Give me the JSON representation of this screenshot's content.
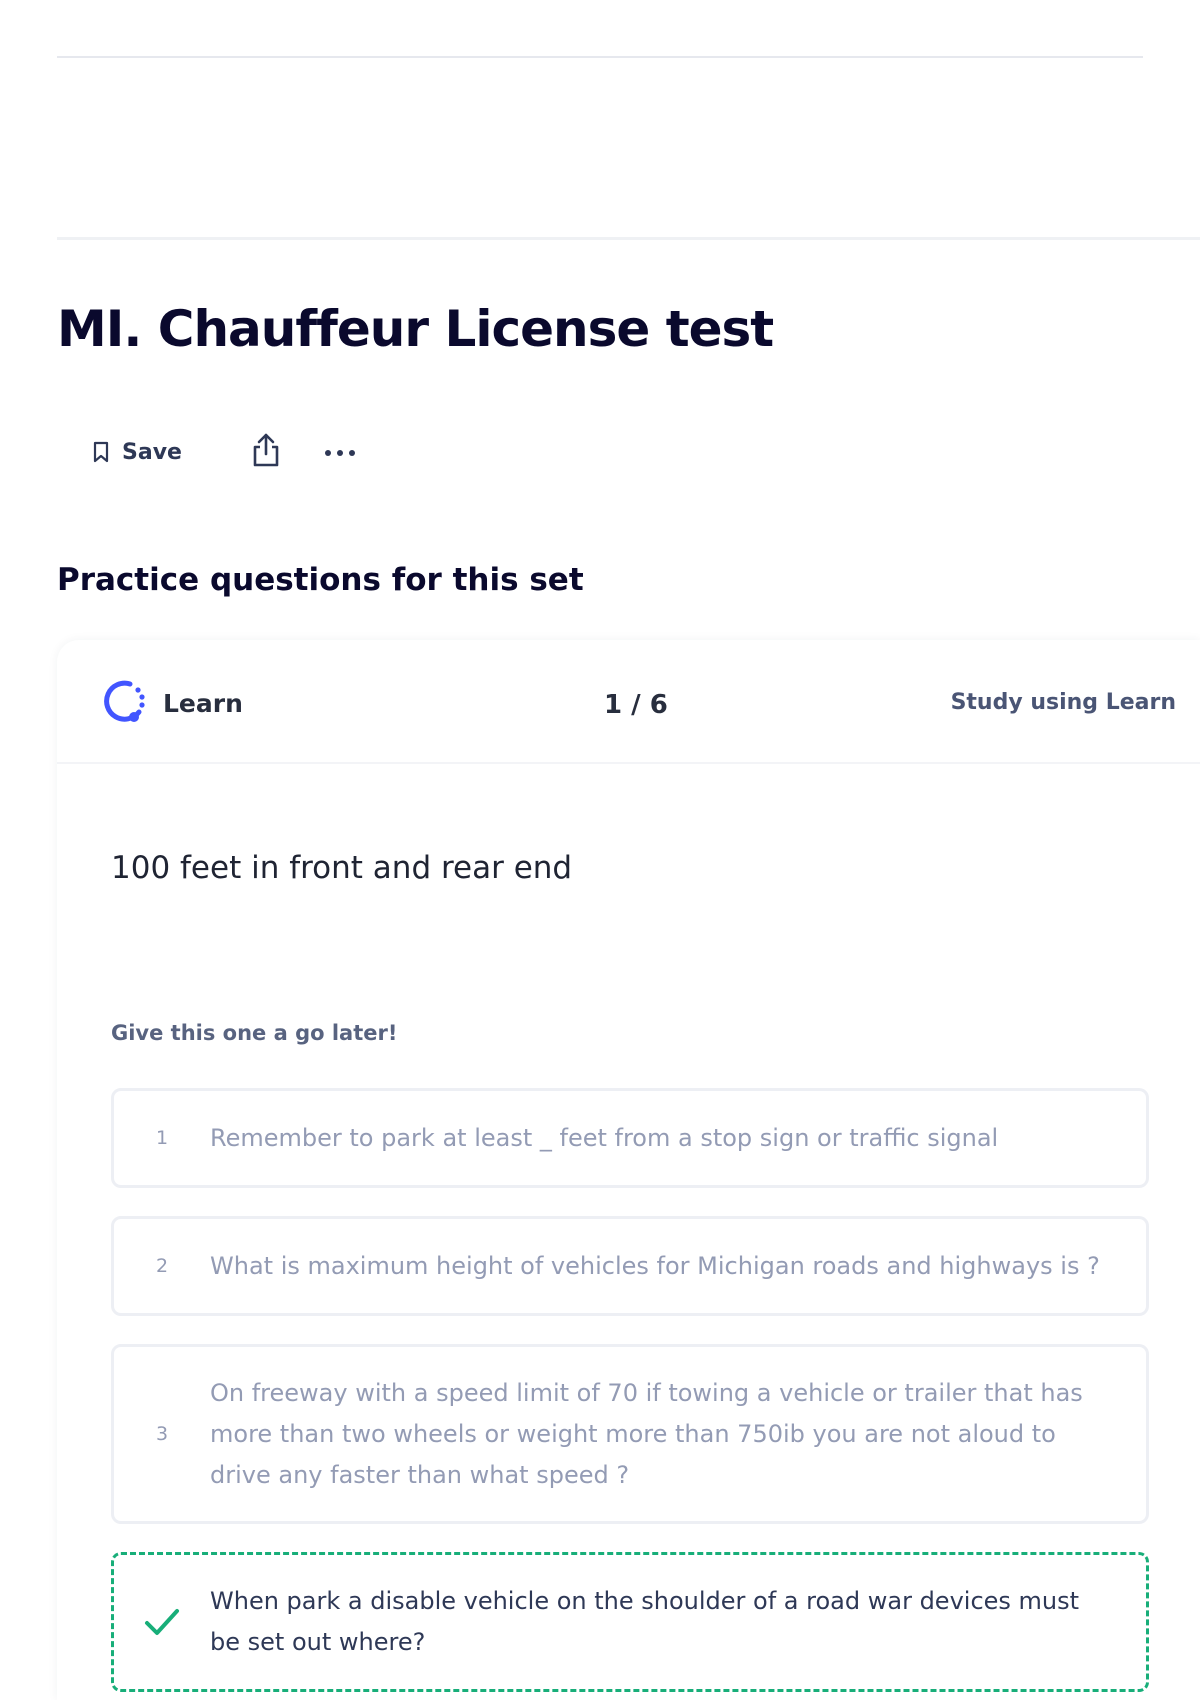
{
  "set": {
    "title": "MI. Chauffeur License test"
  },
  "actions": {
    "save_label": "Save",
    "share_icon": "share-icon",
    "more_icon": "more-horizontal-icon"
  },
  "practice": {
    "heading": "Practice questions for this set"
  },
  "learn_card": {
    "mode_label": "Learn",
    "mode_icon": "learn-progress-icon",
    "counter": "1 / 6",
    "study_link": "Study using Learn",
    "prompt": "100 feet in front and rear end",
    "hint": "Give this one a go later!",
    "options": [
      {
        "number": "1",
        "text": "Remember to park at least _ feet from a stop sign or traffic signal"
      },
      {
        "number": "2",
        "text": "What is maximum height of vehicles for Michigan roads and highways is ?"
      },
      {
        "number": "3",
        "text": "On freeway with a speed limit of 70 if towing a vehicle or trailer that has more than two wheels or weight more than 750ib you are not aloud to drive any faster than what speed ?"
      },
      {
        "text": "When park a disable vehicle on the shoulder of a road war devices must be set out where?",
        "state": "correct"
      }
    ]
  },
  "colors": {
    "accent_learn": "#4255ff",
    "correct_green": "#18ae79"
  }
}
